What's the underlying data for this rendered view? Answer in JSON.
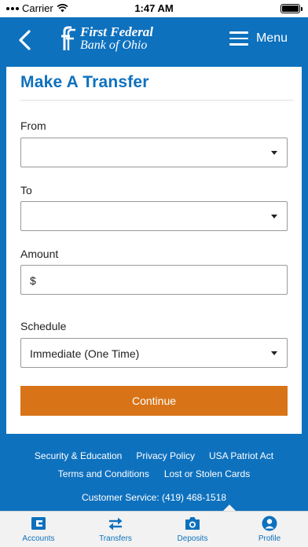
{
  "status_bar": {
    "carrier": "Carrier",
    "time": "1:47 AM"
  },
  "header": {
    "logo_line1": "First Federal",
    "logo_line2": "Bank of Ohio",
    "menu_label": "Menu"
  },
  "form": {
    "title": "Make A Transfer",
    "from_label": "From",
    "from_value": "",
    "to_label": "To",
    "to_value": "",
    "amount_label": "Amount",
    "amount_prefix": "$",
    "schedule_label": "Schedule",
    "schedule_value": "Immediate (One Time)",
    "continue_label": "Continue"
  },
  "footer": {
    "links": [
      "Security & Education",
      "Privacy Policy",
      "USA Patriot Act",
      "Terms and Conditions",
      "Lost or Stolen Cards"
    ],
    "customer_service": "Customer Service: (419) 468-1518"
  },
  "tabs": [
    {
      "label": "Accounts",
      "icon": "accounts-icon"
    },
    {
      "label": "Transfers",
      "icon": "transfer-arrows-icon"
    },
    {
      "label": "Deposits",
      "icon": "camera-icon"
    },
    {
      "label": "Profile",
      "icon": "user-icon"
    }
  ],
  "colors": {
    "brand_blue": "#0e71be",
    "continue_orange": "#d87417"
  }
}
